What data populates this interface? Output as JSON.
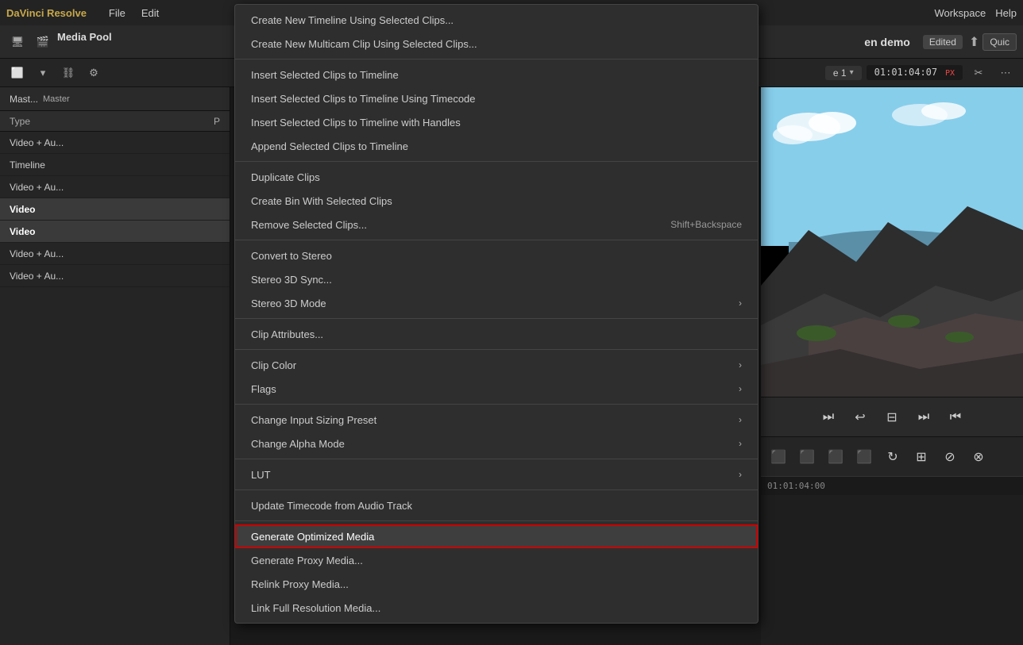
{
  "app": {
    "brand": "DaVinci Resolve",
    "menu_items": [
      "File",
      "Edit"
    ]
  },
  "topbar": {
    "workspace_label": "Workspace",
    "help_label": "Help",
    "project_name": "en demo",
    "edited_badge": "Edited",
    "quick_export": "Quic"
  },
  "toolbar": {
    "timeline_name": "e 1",
    "timecode": "01:01:04:07"
  },
  "media_pool": {
    "title": "Media Pool",
    "breadcrumb": "Mast...",
    "master_label": "Master",
    "col_type": "Type",
    "col_b": "P",
    "items": [
      {
        "name": "Video + Au...",
        "type": ""
      },
      {
        "name": "Timeline",
        "type": ""
      },
      {
        "name": "Video + Au...",
        "type": ""
      },
      {
        "name": "Video",
        "type": "",
        "selected": true
      },
      {
        "name": "Video",
        "type": "",
        "selected": true
      },
      {
        "name": "Video + Au...",
        "type": ""
      },
      {
        "name": "Video + Au...",
        "type": ""
      }
    ]
  },
  "context_menu": {
    "items": [
      {
        "id": "create-timeline",
        "label": "Create New Timeline Using Selected Clips...",
        "shortcut": "",
        "arrow": false,
        "separator_after": false
      },
      {
        "id": "create-multicam",
        "label": "Create New Multicam Clip Using Selected Clips...",
        "shortcut": "",
        "arrow": false,
        "separator_after": true
      },
      {
        "id": "insert-clips",
        "label": "Insert Selected Clips to Timeline",
        "shortcut": "",
        "arrow": false,
        "separator_after": false
      },
      {
        "id": "insert-clips-timecode",
        "label": "Insert Selected Clips to Timeline Using Timecode",
        "shortcut": "",
        "arrow": false,
        "separator_after": false
      },
      {
        "id": "insert-clips-handles",
        "label": "Insert Selected Clips to Timeline with Handles",
        "shortcut": "",
        "arrow": false,
        "separator_after": false
      },
      {
        "id": "append-clips",
        "label": "Append Selected Clips to Timeline",
        "shortcut": "",
        "arrow": false,
        "separator_after": true
      },
      {
        "id": "duplicate-clips",
        "label": "Duplicate Clips",
        "shortcut": "",
        "arrow": false,
        "separator_after": false
      },
      {
        "id": "create-bin",
        "label": "Create Bin With Selected Clips",
        "shortcut": "",
        "arrow": false,
        "separator_after": false
      },
      {
        "id": "remove-clips",
        "label": "Remove Selected Clips...",
        "shortcut": "Shift+Backspace",
        "arrow": false,
        "separator_after": true
      },
      {
        "id": "convert-stereo",
        "label": "Convert to Stereo",
        "shortcut": "",
        "arrow": false,
        "separator_after": false
      },
      {
        "id": "stereo-3d-sync",
        "label": "Stereo 3D Sync...",
        "shortcut": "",
        "arrow": false,
        "separator_after": false
      },
      {
        "id": "stereo-3d-mode",
        "label": "Stereo 3D Mode",
        "shortcut": "",
        "arrow": true,
        "separator_after": true
      },
      {
        "id": "clip-attributes",
        "label": "Clip Attributes...",
        "shortcut": "",
        "arrow": false,
        "separator_after": true
      },
      {
        "id": "clip-color",
        "label": "Clip Color",
        "shortcut": "",
        "arrow": true,
        "separator_after": false
      },
      {
        "id": "flags",
        "label": "Flags",
        "shortcut": "",
        "arrow": true,
        "separator_after": true
      },
      {
        "id": "change-input-sizing",
        "label": "Change Input Sizing Preset",
        "shortcut": "",
        "arrow": true,
        "separator_after": false
      },
      {
        "id": "change-alpha-mode",
        "label": "Change Alpha Mode",
        "shortcut": "",
        "arrow": true,
        "separator_after": true
      },
      {
        "id": "lut",
        "label": "LUT",
        "shortcut": "",
        "arrow": true,
        "separator_after": true
      },
      {
        "id": "update-timecode",
        "label": "Update Timecode from Audio Track",
        "shortcut": "",
        "arrow": false,
        "separator_after": true
      },
      {
        "id": "generate-optimized",
        "label": "Generate Optimized Media",
        "shortcut": "",
        "arrow": false,
        "highlighted": true,
        "separator_after": false
      },
      {
        "id": "generate-proxy",
        "label": "Generate Proxy Media...",
        "shortcut": "",
        "arrow": false,
        "separator_after": false
      },
      {
        "id": "relink-proxy",
        "label": "Relink Proxy Media...",
        "shortcut": "",
        "arrow": false,
        "separator_after": false
      },
      {
        "id": "link-full-res",
        "label": "Link Full Resolution Media...",
        "shortcut": "",
        "arrow": false,
        "separator_after": false
      }
    ]
  },
  "preview": {
    "timecode_display": "01:01:04:00"
  },
  "playback_controls": {
    "buttons": [
      "⏮",
      "⏭",
      "↩",
      "⊟",
      "⏭",
      "⏮"
    ]
  },
  "transport_buttons": [
    "⬛",
    "⬛",
    "⬛",
    "⬛",
    "⬛",
    "↻",
    "⊞",
    "⬛"
  ]
}
